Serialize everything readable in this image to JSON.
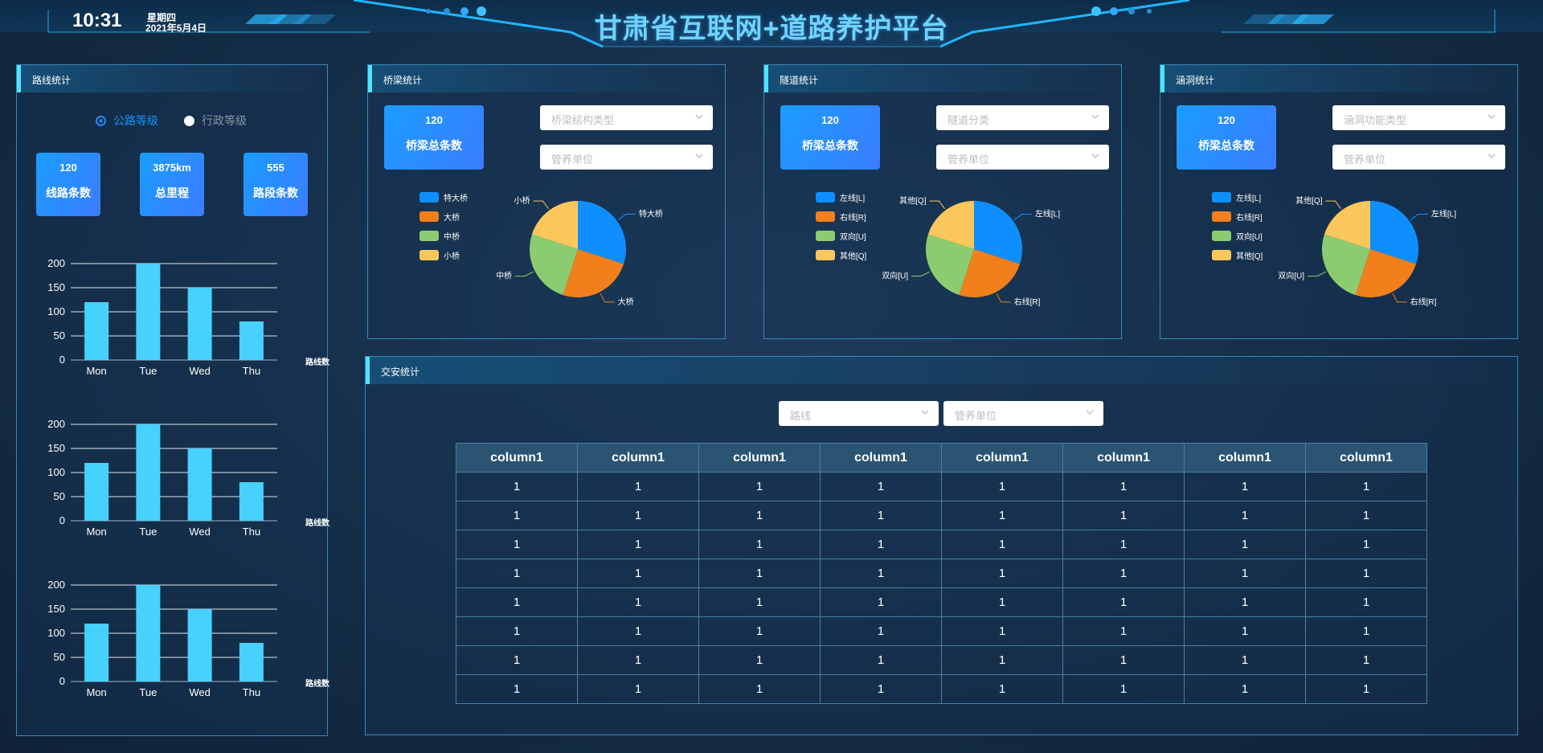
{
  "header": {
    "time": "10:31",
    "weekday": "星期四",
    "date": "2021年5月4日",
    "title": "甘肃省互联网+道路养护平台"
  },
  "colors": {
    "accent": "#4fe4ff",
    "bar": "#46d1ff",
    "pie": [
      "#0f8fff",
      "#f07f1c",
      "#8ccc70",
      "#fbc75a"
    ],
    "card": "#1a9dff"
  },
  "route_panel": {
    "title": "路线统计",
    "radios": [
      {
        "label": "公路等级",
        "checked": true
      },
      {
        "label": "行政等级",
        "checked": false
      }
    ],
    "stats": [
      {
        "value": "120",
        "label": "线路条数"
      },
      {
        "value": "3875km",
        "label": "总里程"
      },
      {
        "value": "555",
        "label": "路段条数"
      }
    ]
  },
  "bridge_panel": {
    "title": "桥梁统计",
    "stat": {
      "value": "120",
      "label": "桥梁总条数"
    },
    "dropdowns": [
      "桥梁结构类型",
      "管养单位"
    ]
  },
  "tunnel_panel": {
    "title": "隧道统计",
    "stat": {
      "value": "120",
      "label": "桥梁总条数"
    },
    "dropdowns": [
      "隧道分类",
      "管养单位"
    ]
  },
  "culvert_panel": {
    "title": "涵洞统计",
    "stat": {
      "value": "120",
      "label": "桥梁总条数"
    },
    "dropdowns": [
      "涵洞功能类型",
      "管养单位"
    ]
  },
  "traffic_panel": {
    "title": "交安统计",
    "dropdowns": [
      "路线",
      "管养单位"
    ],
    "table": {
      "headers": [
        "column1",
        "column1",
        "column1",
        "column1",
        "column1",
        "column1",
        "column1",
        "column1"
      ],
      "rows": [
        [
          "1",
          "1",
          "1",
          "1",
          "1",
          "1",
          "1",
          "1"
        ],
        [
          "1",
          "1",
          "1",
          "1",
          "1",
          "1",
          "1",
          "1"
        ],
        [
          "1",
          "1",
          "1",
          "1",
          "1",
          "1",
          "1",
          "1"
        ],
        [
          "1",
          "1",
          "1",
          "1",
          "1",
          "1",
          "1",
          "1"
        ],
        [
          "1",
          "1",
          "1",
          "1",
          "1",
          "1",
          "1",
          "1"
        ],
        [
          "1",
          "1",
          "1",
          "1",
          "1",
          "1",
          "1",
          "1"
        ],
        [
          "1",
          "1",
          "1",
          "1",
          "1",
          "1",
          "1",
          "1"
        ],
        [
          "1",
          "1",
          "1",
          "1",
          "1",
          "1",
          "1",
          "1"
        ]
      ]
    }
  },
  "chart_data": [
    {
      "type": "bar",
      "categories": [
        "Mon",
        "Tue",
        "Wed",
        "Thu"
      ],
      "values": [
        120,
        200,
        150,
        80
      ],
      "ylim": [
        0,
        200
      ],
      "yticks": [
        0,
        50,
        100,
        150,
        200
      ],
      "xlabel": "",
      "ylabel": "路线数量",
      "grid": true
    },
    {
      "type": "bar",
      "categories": [
        "Mon",
        "Tue",
        "Wed",
        "Thu"
      ],
      "values": [
        120,
        200,
        150,
        80
      ],
      "ylim": [
        0,
        200
      ],
      "yticks": [
        0,
        50,
        100,
        150,
        200
      ],
      "xlabel": "",
      "ylabel": "路线数量",
      "grid": true
    },
    {
      "type": "bar",
      "categories": [
        "Mon",
        "Tue",
        "Wed",
        "Thu"
      ],
      "values": [
        120,
        200,
        150,
        80
      ],
      "ylim": [
        0,
        200
      ],
      "yticks": [
        0,
        50,
        100,
        150,
        200
      ],
      "xlabel": "",
      "ylabel": "路线数量",
      "grid": true
    },
    {
      "type": "pie",
      "labels": [
        "特大桥",
        "大桥",
        "中桥",
        "小桥"
      ],
      "values": [
        30,
        25,
        25,
        20
      ],
      "legend": "left"
    },
    {
      "type": "pie",
      "labels": [
        "左线[L]",
        "右线[R]",
        "双向[U]",
        "其他[Q]"
      ],
      "values": [
        30,
        25,
        25,
        20
      ],
      "legend": "left"
    },
    {
      "type": "pie",
      "labels": [
        "左线[L]",
        "右线[R]",
        "双向[U]",
        "其他[Q]"
      ],
      "values": [
        30,
        25,
        25,
        20
      ],
      "legend": "left"
    }
  ]
}
